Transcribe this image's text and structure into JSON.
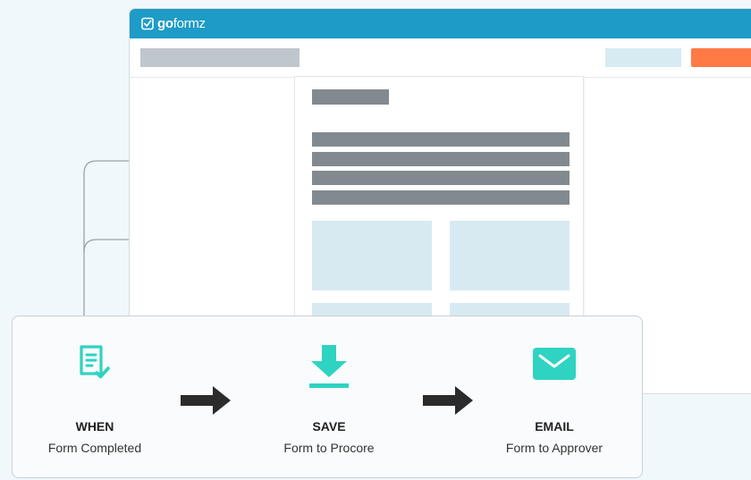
{
  "app": {
    "brand_bold": "go",
    "brand_regular": "formz"
  },
  "icons": {
    "logo": "checkbox-logo-icon",
    "when": "form-checklist-icon",
    "save": "download-icon",
    "email": "envelope-icon",
    "arrow": "right-arrow-icon"
  },
  "colors": {
    "titlebar": "#1e9bc6",
    "accent_teal": "#2ed3c2",
    "orange_button": "#ff7a45",
    "arrow": "#2b2b2b"
  },
  "workflow": {
    "steps": [
      {
        "title": "WHEN",
        "subtitle": "Form Completed"
      },
      {
        "title": "SAVE",
        "subtitle": "Form to Procore"
      },
      {
        "title": "EMAIL",
        "subtitle": "Form to Approver"
      }
    ]
  }
}
